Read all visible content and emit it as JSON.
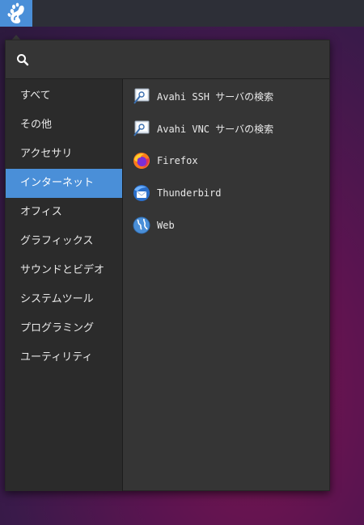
{
  "panel": {
    "app_button_icon": "gnome-foot-icon",
    "accent": "#4a8fd8"
  },
  "menu": {
    "search": {
      "icon": "search-icon",
      "value": "",
      "placeholder": ""
    },
    "categories": [
      {
        "label": "すべて",
        "active": false
      },
      {
        "label": "その他",
        "active": false
      },
      {
        "label": "アクセサリ",
        "active": false
      },
      {
        "label": "インターネット",
        "active": true
      },
      {
        "label": "オフィス",
        "active": false
      },
      {
        "label": "グラフィックス",
        "active": false
      },
      {
        "label": "サウンドとビデオ",
        "active": false
      },
      {
        "label": "システムツール",
        "active": false
      },
      {
        "label": "プログラミング",
        "active": false
      },
      {
        "label": "ユーティリティ",
        "active": false
      }
    ],
    "apps": [
      {
        "label": "Avahi SSH サーバの検索",
        "icon": "network-search-icon"
      },
      {
        "label": "Avahi VNC サーバの検索",
        "icon": "network-search-icon"
      },
      {
        "label": "Firefox",
        "icon": "firefox-icon"
      },
      {
        "label": "Thunderbird",
        "icon": "thunderbird-icon"
      },
      {
        "label": "Web",
        "icon": "web-browser-icon"
      }
    ]
  }
}
